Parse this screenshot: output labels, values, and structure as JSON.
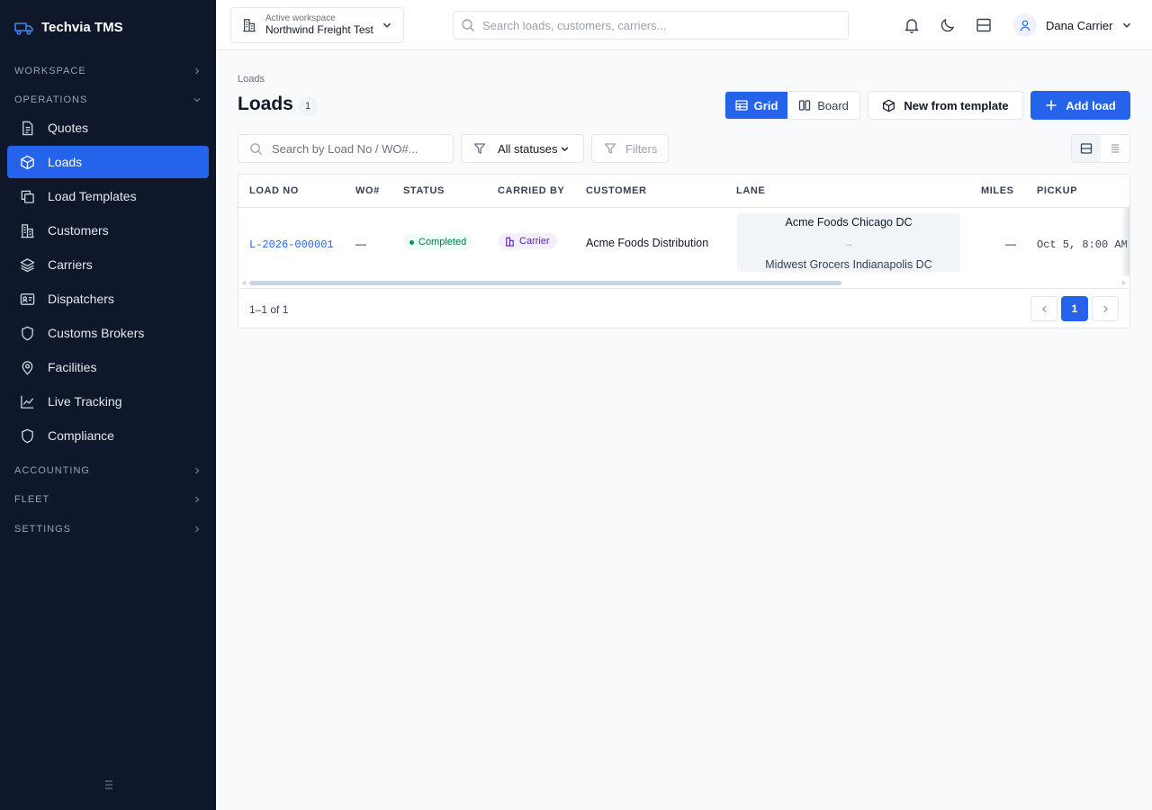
{
  "brand": {
    "name": "Techvia TMS",
    "icon": "truck-icon"
  },
  "sidebar": {
    "sections": [
      {
        "label": "WORKSPACE",
        "state": "collapsed"
      },
      {
        "label": "OPERATIONS",
        "state": "expanded"
      },
      {
        "label": "ACCOUNTING",
        "state": "collapsed"
      },
      {
        "label": "FLEET",
        "state": "collapsed"
      },
      {
        "label": "SETTINGS",
        "state": "collapsed"
      }
    ],
    "items": [
      {
        "label": "Quotes",
        "icon": "document-icon"
      },
      {
        "label": "Loads",
        "icon": "box-icon",
        "active": true
      },
      {
        "label": "Load Templates",
        "icon": "copy-icon"
      },
      {
        "label": "Customers",
        "icon": "building-icon"
      },
      {
        "label": "Carriers",
        "icon": "layers-icon"
      },
      {
        "label": "Dispatchers",
        "icon": "id-card-icon"
      },
      {
        "label": "Customs Brokers",
        "icon": "shield-icon"
      },
      {
        "label": "Facilities",
        "icon": "map-pin-icon"
      },
      {
        "label": "Live Tracking",
        "icon": "chart-line-icon"
      },
      {
        "label": "Compliance",
        "icon": "shield-icon"
      }
    ]
  },
  "topbar": {
    "workspace_label": "Active workspace",
    "workspace_name": "Northwind Freight Test",
    "search_placeholder": "Search loads, customers, carriers...",
    "user_name": "Dana Carrier"
  },
  "page": {
    "breadcrumb": "Loads",
    "title": "Loads",
    "count": "1",
    "view_grid": "Grid",
    "view_board": "Board",
    "new_from_template": "New from template",
    "add_load": "Add load"
  },
  "filters": {
    "search_placeholder": "Search by Load No / WO#...",
    "status": "All statuses",
    "filters_label": "Filters"
  },
  "table": {
    "columns": [
      "LOAD NO",
      "WO#",
      "STATUS",
      "CARRIED BY",
      "CUSTOMER",
      "LANE",
      "MILES",
      "PICKUP"
    ],
    "rows": [
      {
        "load_no": "L-2026-000001",
        "wo": "—",
        "status": "Completed",
        "carried_by": "Carrier",
        "customer": "Acme Foods Distribution",
        "lane_from": "Acme Foods Chicago DC",
        "lane_arrow": "→",
        "lane_to": "Midwest Grocers Indianapolis DC",
        "miles": "—",
        "pickup": "Oct 5, 8:00 AM"
      }
    ],
    "range": "1–1 of 1",
    "current_page": "1"
  },
  "colors": {
    "accent": "#2563eb",
    "sidebar_bg": "#0f172a",
    "success": "#047857",
    "carrier": "#5b21b6"
  }
}
